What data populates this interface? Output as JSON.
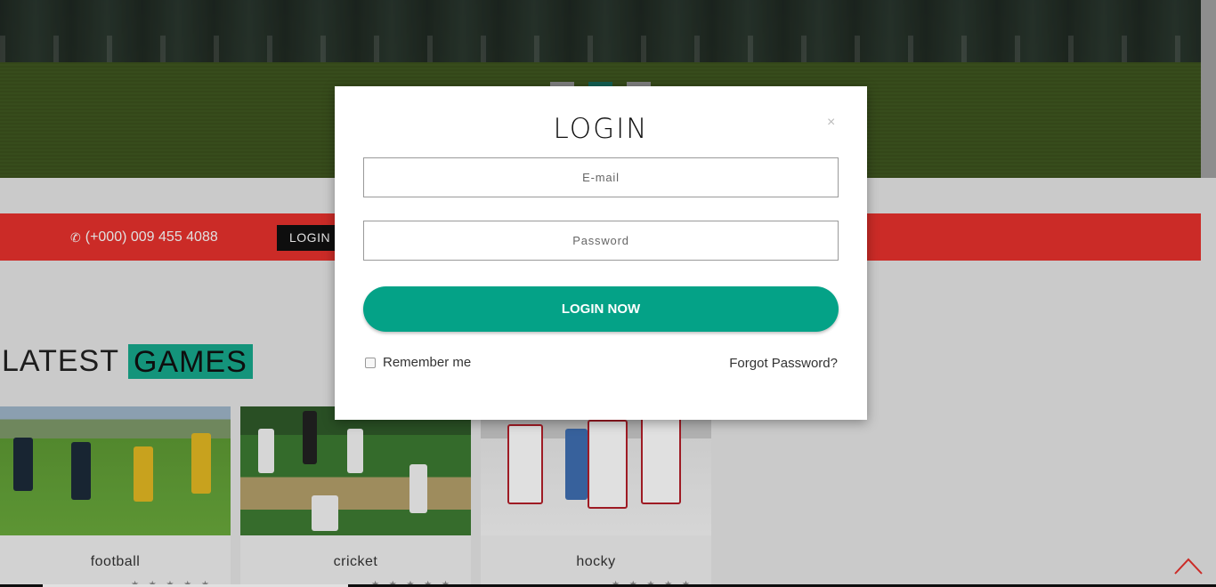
{
  "hero": {
    "slides": 3,
    "active_slide": 2
  },
  "contact": {
    "phone": "(+000) 009 455 4088",
    "phone_icon": "phone-icon"
  },
  "nav": {
    "login_label": "LOGIN"
  },
  "section": {
    "heading_plain": "LATEST",
    "heading_accent": "GAMES"
  },
  "cards": [
    {
      "title": "football"
    },
    {
      "title": "cricket"
    },
    {
      "title": "hocky"
    }
  ],
  "stars_glyph": "★ ★ ★ ★ ★",
  "modal": {
    "title": "LOGIN",
    "close_label": "×",
    "email_placeholder": "E-mail",
    "password_placeholder": "Password",
    "submit_label": "LOGIN NOW",
    "remember_label": "Remember me",
    "forgot_label": "Forgot Password?"
  },
  "colors": {
    "accent": "#04a287",
    "red": "#e8322d"
  }
}
